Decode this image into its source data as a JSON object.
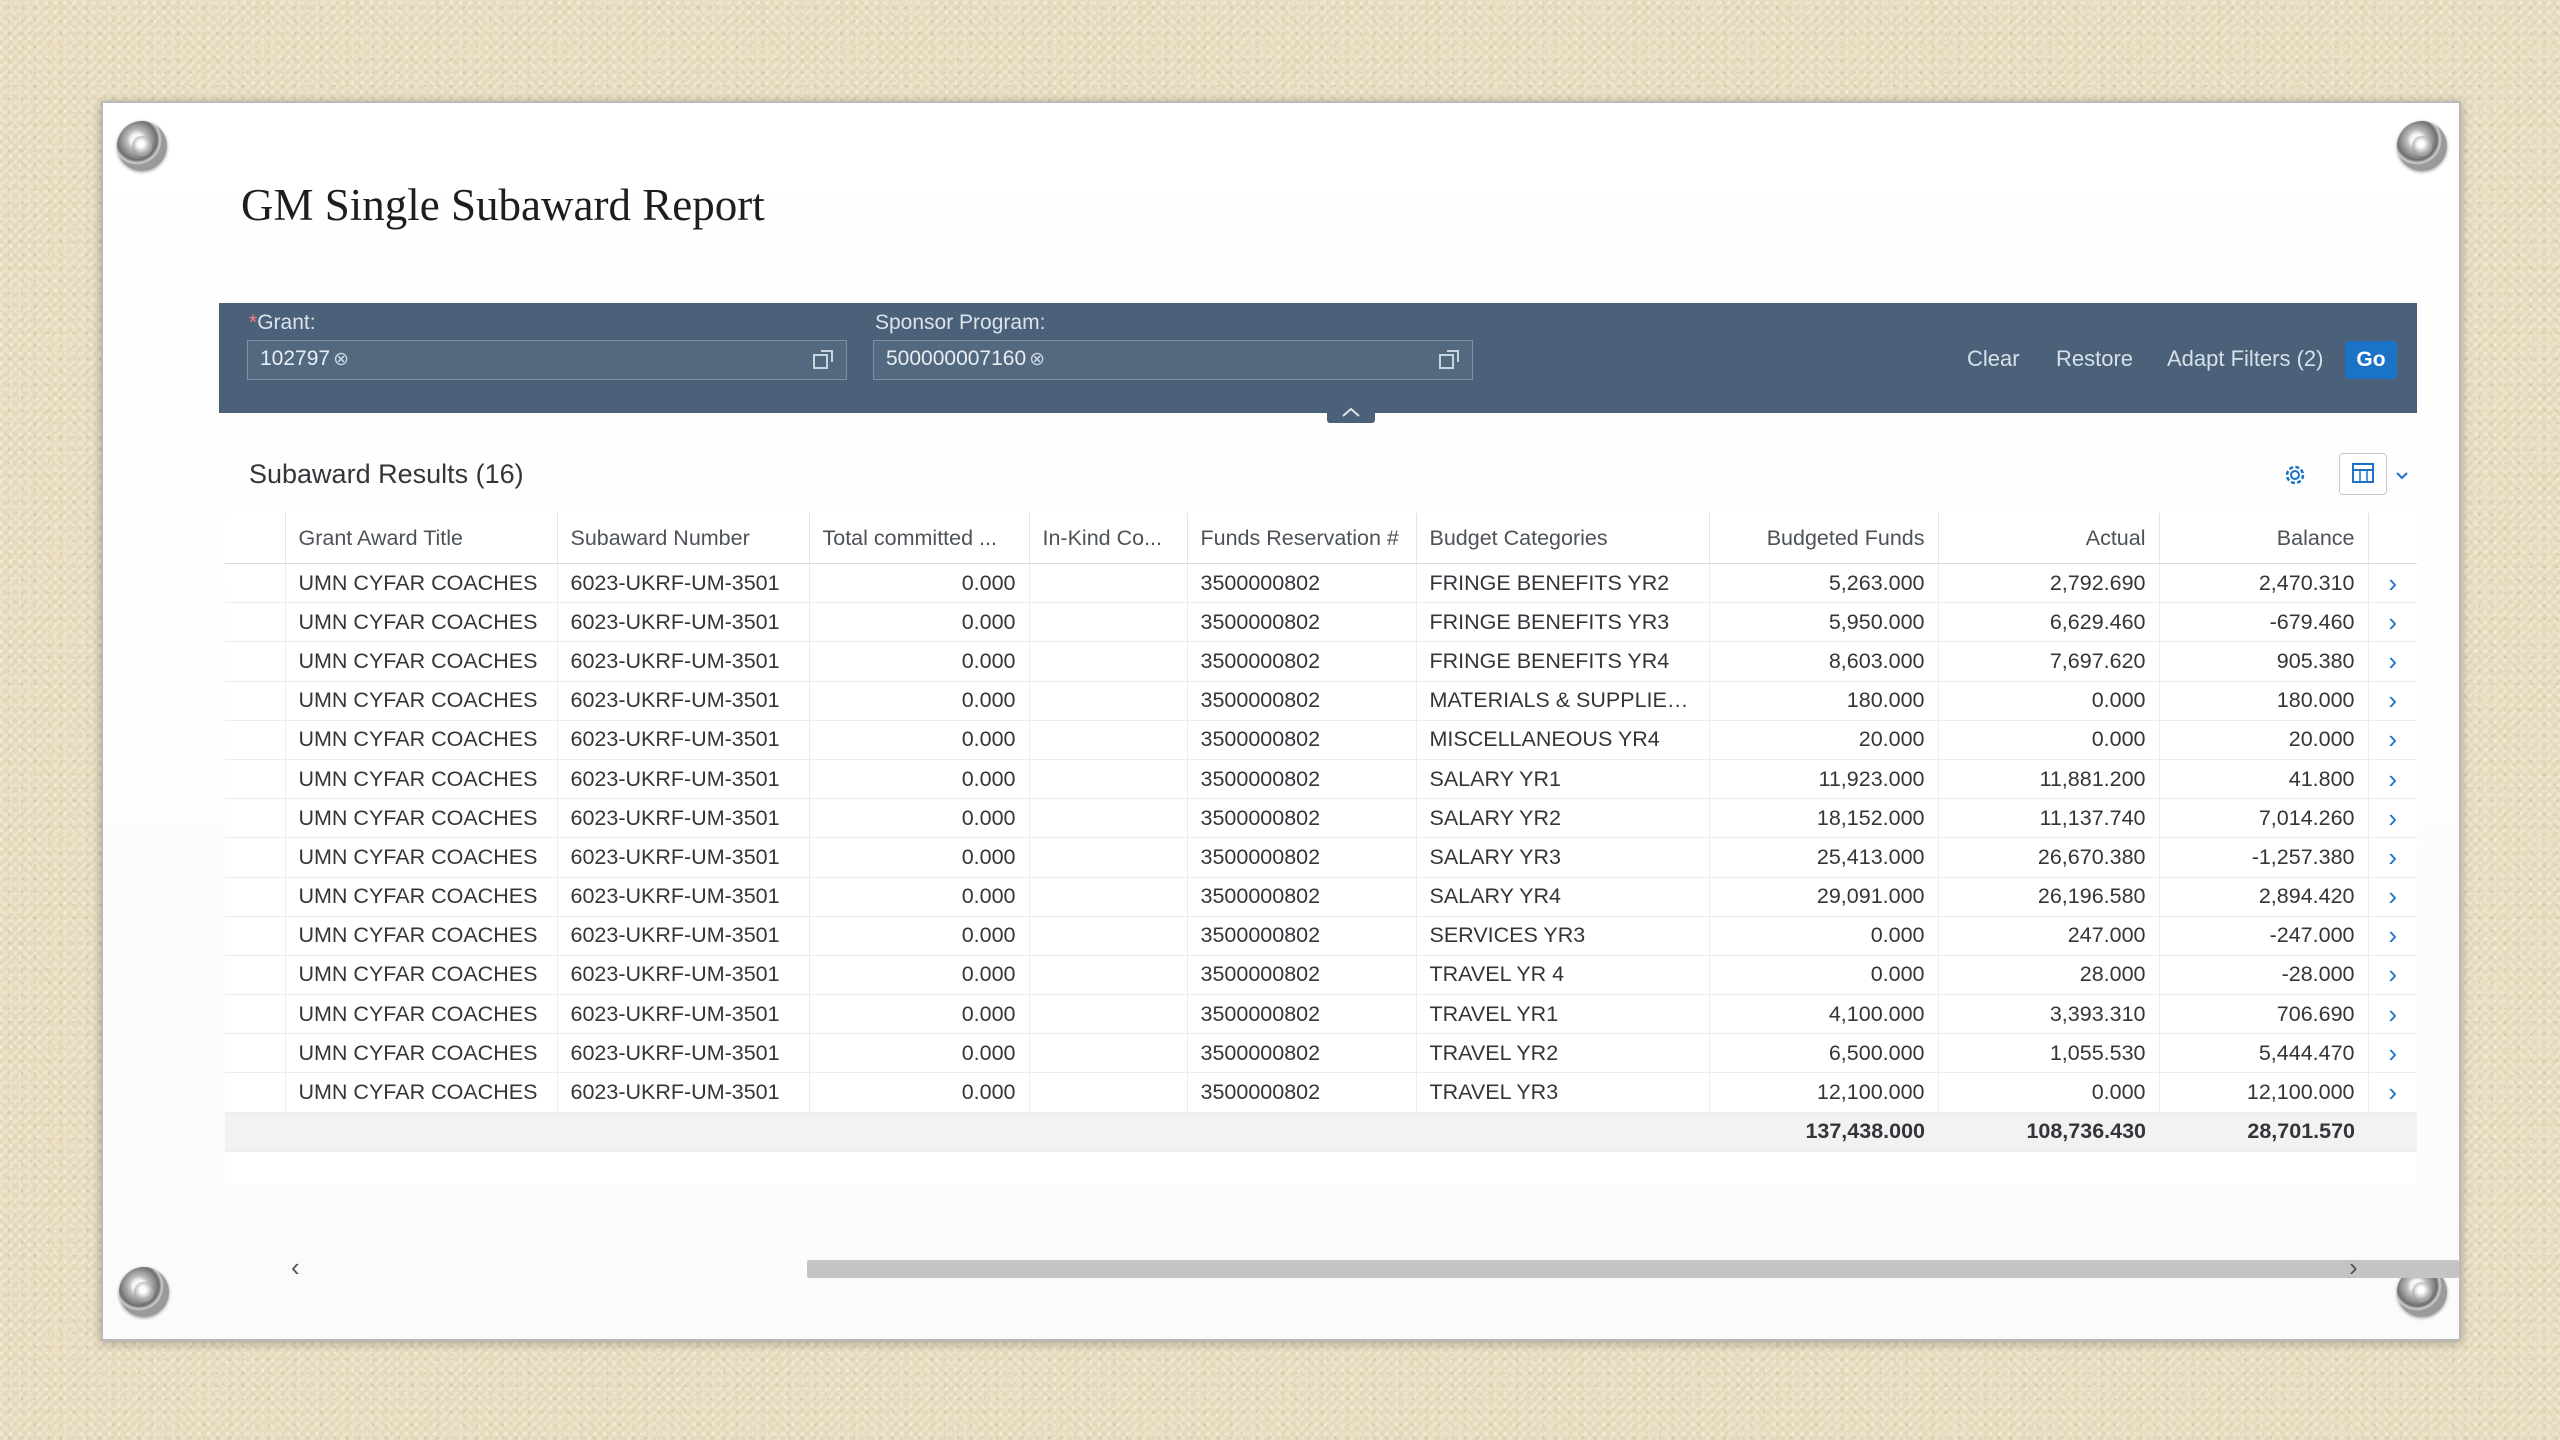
{
  "report": {
    "title": "GM Single Subaward Report"
  },
  "filters": {
    "grant_label": "Grant:",
    "grant_required_mark": "*",
    "grant_value": "102797",
    "sponsor_label": "Sponsor Program:",
    "sponsor_value": "500000007160",
    "token_remove_glyph": "⊗",
    "clear_label": "Clear",
    "restore_label": "Restore",
    "adapt_label": "Adapt Filters (2)",
    "go_label": "Go"
  },
  "results": {
    "title": "Subaward Results (16)",
    "columns": [
      "Grant Award Title",
      "Subaward Number",
      "Total committed ...",
      "In-Kind Co...",
      "Funds Reservation #",
      "Budget Categories",
      "Budgeted Funds",
      "Actual",
      "Balance"
    ],
    "rows": [
      {
        "title": "UMN CYFAR COACHES",
        "subaward": "6023-UKRF-UM-3501",
        "committed": "0.000",
        "inkind": "",
        "reservation": "3500000802",
        "category": "FRINGE BENEFITS YR2",
        "budgeted": "5,263.000",
        "actual": "2,792.690",
        "balance": "2,470.310"
      },
      {
        "title": "UMN CYFAR COACHES",
        "subaward": "6023-UKRF-UM-3501",
        "committed": "0.000",
        "inkind": "",
        "reservation": "3500000802",
        "category": "FRINGE BENEFITS YR3",
        "budgeted": "5,950.000",
        "actual": "6,629.460",
        "balance": "-679.460"
      },
      {
        "title": "UMN CYFAR COACHES",
        "subaward": "6023-UKRF-UM-3501",
        "committed": "0.000",
        "inkind": "",
        "reservation": "3500000802",
        "category": "FRINGE BENEFITS YR4",
        "budgeted": "8,603.000",
        "actual": "7,697.620",
        "balance": "905.380"
      },
      {
        "title": "UMN CYFAR COACHES",
        "subaward": "6023-UKRF-UM-3501",
        "committed": "0.000",
        "inkind": "",
        "reservation": "3500000802",
        "category": "MATERIALS & SUPPLIES ...",
        "budgeted": "180.000",
        "actual": "0.000",
        "balance": "180.000"
      },
      {
        "title": "UMN CYFAR COACHES",
        "subaward": "6023-UKRF-UM-3501",
        "committed": "0.000",
        "inkind": "",
        "reservation": "3500000802",
        "category": "MISCELLANEOUS YR4",
        "budgeted": "20.000",
        "actual": "0.000",
        "balance": "20.000"
      },
      {
        "title": "UMN CYFAR COACHES",
        "subaward": "6023-UKRF-UM-3501",
        "committed": "0.000",
        "inkind": "",
        "reservation": "3500000802",
        "category": "SALARY YR1",
        "budgeted": "11,923.000",
        "actual": "11,881.200",
        "balance": "41.800"
      },
      {
        "title": "UMN CYFAR COACHES",
        "subaward": "6023-UKRF-UM-3501",
        "committed": "0.000",
        "inkind": "",
        "reservation": "3500000802",
        "category": "SALARY YR2",
        "budgeted": "18,152.000",
        "actual": "11,137.740",
        "balance": "7,014.260"
      },
      {
        "title": "UMN CYFAR COACHES",
        "subaward": "6023-UKRF-UM-3501",
        "committed": "0.000",
        "inkind": "",
        "reservation": "3500000802",
        "category": "SALARY YR3",
        "budgeted": "25,413.000",
        "actual": "26,670.380",
        "balance": "-1,257.380"
      },
      {
        "title": "UMN CYFAR COACHES",
        "subaward": "6023-UKRF-UM-3501",
        "committed": "0.000",
        "inkind": "",
        "reservation": "3500000802",
        "category": "SALARY YR4",
        "budgeted": "29,091.000",
        "actual": "26,196.580",
        "balance": "2,894.420"
      },
      {
        "title": "UMN CYFAR COACHES",
        "subaward": "6023-UKRF-UM-3501",
        "committed": "0.000",
        "inkind": "",
        "reservation": "3500000802",
        "category": "SERVICES YR3",
        "budgeted": "0.000",
        "actual": "247.000",
        "balance": "-247.000"
      },
      {
        "title": "UMN CYFAR COACHES",
        "subaward": "6023-UKRF-UM-3501",
        "committed": "0.000",
        "inkind": "",
        "reservation": "3500000802",
        "category": "TRAVEL YR 4",
        "budgeted": "0.000",
        "actual": "28.000",
        "balance": "-28.000"
      },
      {
        "title": "UMN CYFAR COACHES",
        "subaward": "6023-UKRF-UM-3501",
        "committed": "0.000",
        "inkind": "",
        "reservation": "3500000802",
        "category": "TRAVEL YR1",
        "budgeted": "4,100.000",
        "actual": "3,393.310",
        "balance": "706.690"
      },
      {
        "title": "UMN CYFAR COACHES",
        "subaward": "6023-UKRF-UM-3501",
        "committed": "0.000",
        "inkind": "",
        "reservation": "3500000802",
        "category": "TRAVEL YR2",
        "budgeted": "6,500.000",
        "actual": "1,055.530",
        "balance": "5,444.470"
      },
      {
        "title": "UMN CYFAR COACHES",
        "subaward": "6023-UKRF-UM-3501",
        "committed": "0.000",
        "inkind": "",
        "reservation": "3500000802",
        "category": "TRAVEL YR3",
        "budgeted": "12,100.000",
        "actual": "0.000",
        "balance": "12,100.000"
      }
    ],
    "totals": {
      "budgeted": "137,438.000",
      "actual": "108,736.430",
      "balance": "28,701.570"
    },
    "row_nav_glyph": "›"
  },
  "icons": {
    "value_help": "value-help-icon",
    "settings": "gear-icon",
    "export": "export-spreadsheet-icon",
    "collapse": "chevron-up-icon"
  },
  "colors": {
    "filter_bar": "#4a6179",
    "go_button": "#1a73c7",
    "nav_arrow": "#1a73c7"
  }
}
